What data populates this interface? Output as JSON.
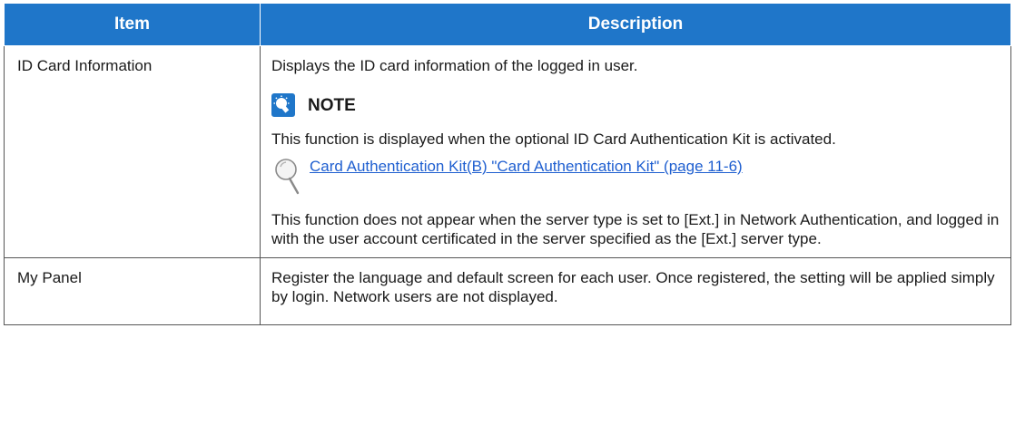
{
  "table": {
    "headers": {
      "item": "Item",
      "description": "Description"
    },
    "rows": [
      {
        "item": "ID Card Information",
        "intro": "Displays the ID card information of the logged in user.",
        "note_label": "NOTE",
        "note_text": "This function is displayed when the optional ID Card Authentication Kit is activated.",
        "reference_link": "Card Authentication Kit(B) \"Card Authentication Kit\" (page 11-6)",
        "extra_text": "This function does not appear when the server type is set to [Ext.] in Network Authentication, and logged in with the user account certificated in the server specified as the [Ext.] server type."
      },
      {
        "item": "My Panel",
        "description": "Register the language and default screen for each user. Once registered, the setting will be applied simply by login. Network users are not displayed."
      }
    ]
  },
  "icons": {
    "note": "lightbulb-icon",
    "reference": "magnifier-icon"
  },
  "colors": {
    "header_background": "#1f76c9",
    "link": "#1f5fd0"
  }
}
